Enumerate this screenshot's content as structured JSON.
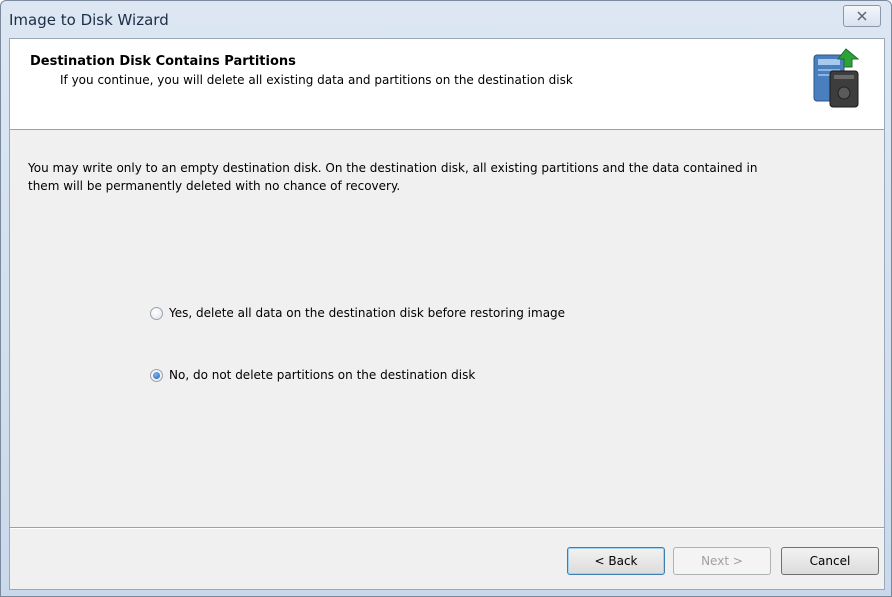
{
  "window": {
    "title": "Image to Disk Wizard",
    "close_icon": "close-x-icon"
  },
  "header": {
    "title": "Destination Disk Contains Partitions",
    "subtitle": "If you continue, you will delete all existing data and partitions on the destination disk",
    "icon": "disk-image-icon"
  },
  "body": {
    "message": "You may write only to an empty destination disk. On the destination disk, all existing partitions and the data contained in them will be permanently deleted with no chance of recovery."
  },
  "options": [
    {
      "label": "Yes, delete all data on the destination disk before restoring image",
      "checked": false
    },
    {
      "label": "No, do not delete partitions on the destination disk",
      "checked": true
    }
  ],
  "buttons": {
    "back": "< Back",
    "next": "Next >",
    "cancel": "Cancel",
    "next_enabled": false
  }
}
